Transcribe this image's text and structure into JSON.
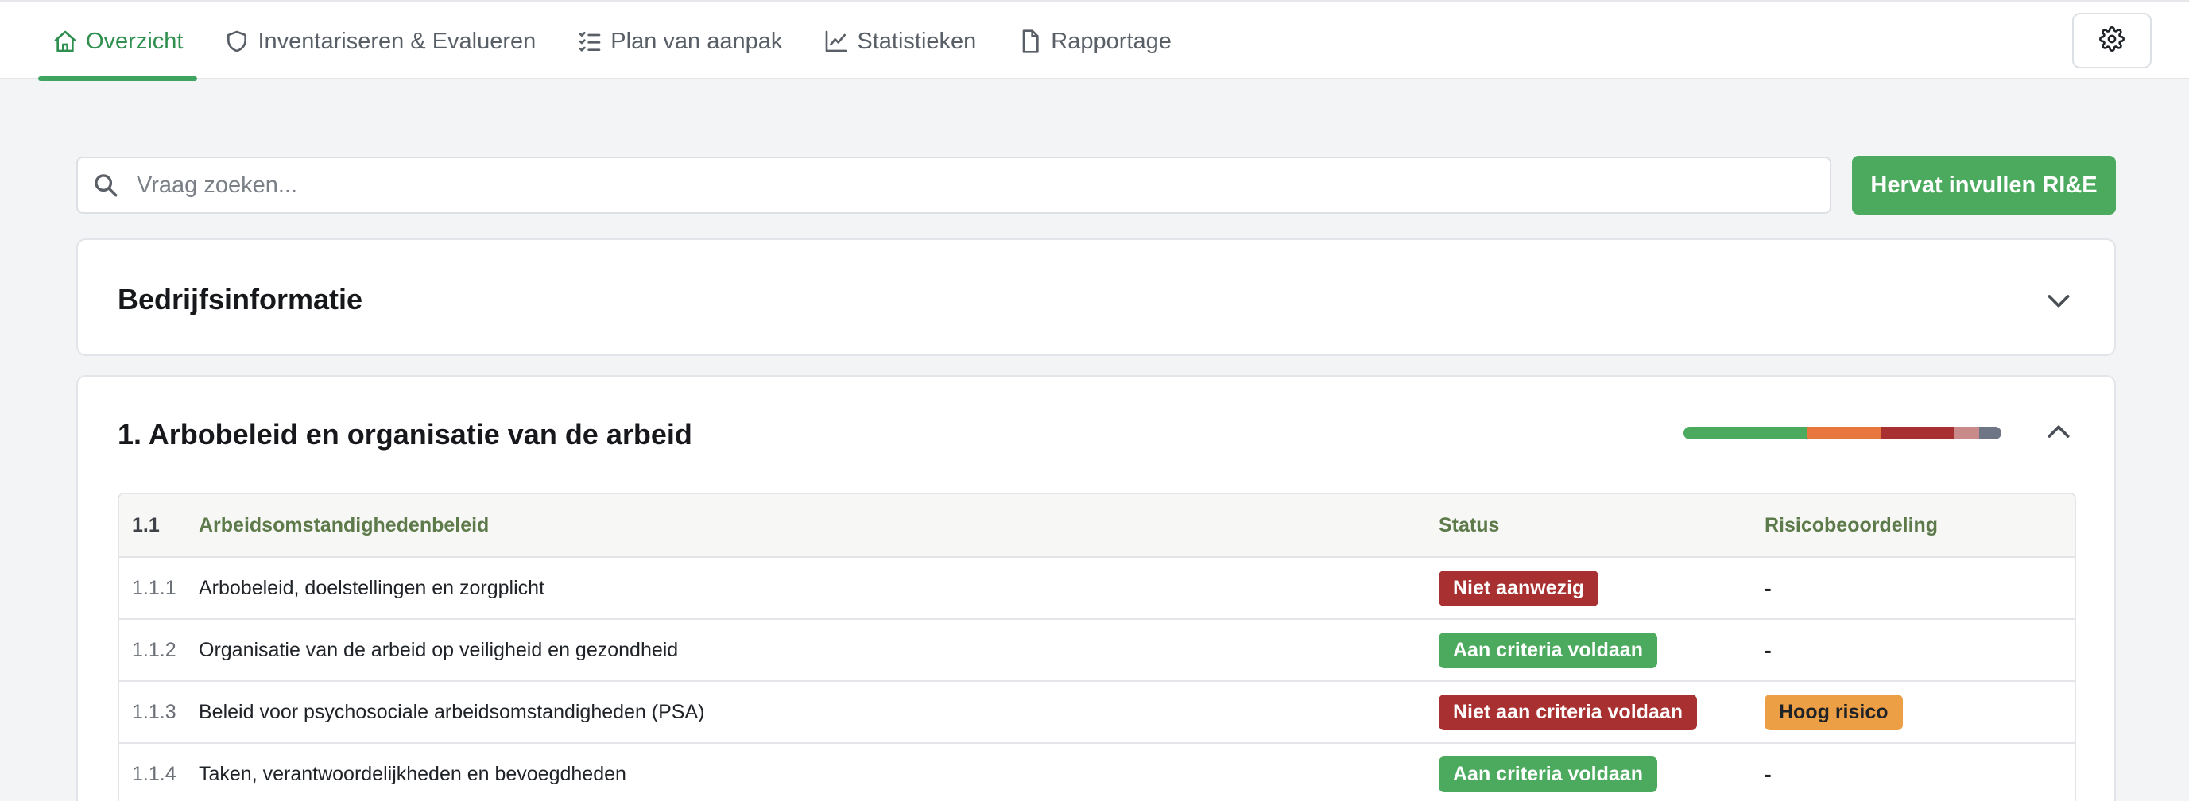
{
  "nav": {
    "tabs": [
      {
        "label": "Overzicht",
        "icon": "home-icon",
        "active": true
      },
      {
        "label": "Inventariseren & Evalueren",
        "icon": "shield-icon",
        "active": false
      },
      {
        "label": "Plan van aanpak",
        "icon": "checklist-icon",
        "active": false
      },
      {
        "label": "Statistieken",
        "icon": "line-chart-icon",
        "active": false
      },
      {
        "label": "Rapportage",
        "icon": "document-icon",
        "active": false
      }
    ],
    "settings_icon": "gear-icon"
  },
  "search": {
    "placeholder": "Vraag zoeken...",
    "value": ""
  },
  "resume_button": "Hervat invullen RI&E",
  "company_card": {
    "title": "Bedrijfsinformatie",
    "expanded": false
  },
  "section": {
    "title": "1. Arbobeleid en organisatie van de arbeid",
    "expanded": true,
    "progress": [
      {
        "color": "#4caa5f",
        "fraction": 0.39
      },
      {
        "color": "#e8773f",
        "fraction": 0.23
      },
      {
        "color": "#a83030",
        "fraction": 0.23
      },
      {
        "color": "#c98a8a",
        "fraction": 0.08
      },
      {
        "color": "#6e7686",
        "fraction": 0.07
      }
    ],
    "table": {
      "header": {
        "num": "1.1",
        "name": "Arbeidsomstandighedenbeleid",
        "status": "Status",
        "risk": "Risicobeoordeling"
      },
      "rows": [
        {
          "num": "1.1.1",
          "name": "Arbobeleid, doelstellingen en zorgplicht",
          "status": "Niet aanwezig",
          "status_color": "red",
          "risk": "-",
          "risk_color": ""
        },
        {
          "num": "1.1.2",
          "name": "Organisatie van de arbeid op veiligheid en gezondheid",
          "status": "Aan criteria voldaan",
          "status_color": "green",
          "risk": "-",
          "risk_color": ""
        },
        {
          "num": "1.1.3",
          "name": "Beleid voor psychosociale arbeidsomstandigheden (PSA)",
          "status": "Niet aan criteria voldaan",
          "status_color": "red",
          "risk": "Hoog risico",
          "risk_color": "orange"
        },
        {
          "num": "1.1.4",
          "name": "Taken, verantwoordelijkheden en bevoegdheden",
          "status": "Aan criteria voldaan",
          "status_color": "green",
          "risk": "-",
          "risk_color": ""
        }
      ]
    }
  },
  "colors": {
    "accent": "#2e8f4f",
    "primary_button": "#4caa5f",
    "badge_red": "#a83030",
    "badge_green": "#4caa5f",
    "badge_orange": "#ec9f45"
  }
}
